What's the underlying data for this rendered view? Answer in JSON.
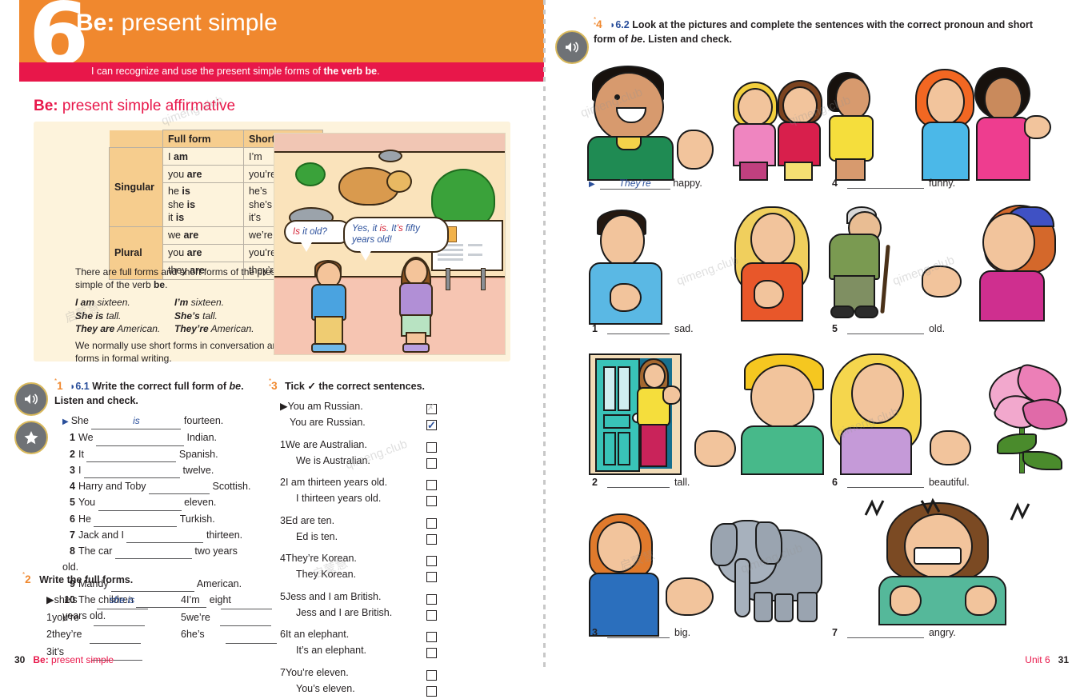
{
  "unit": {
    "number": "6",
    "title_bold": "Be:",
    "title_rest": " present simple",
    "can_do_prefix": "I can recognize and use the present simple forms of ",
    "can_do_bold": "the verb be",
    "can_do_suffix": "."
  },
  "section": {
    "title_bold": "Be:",
    "title_rest": " present simple affirmative"
  },
  "grammar_table": {
    "headers": [
      "",
      "Full form",
      "Short form"
    ],
    "groups": [
      {
        "label": "Singular",
        "rows": [
          {
            "full": "I am",
            "full_bold": "am",
            "short": "I’m"
          },
          {
            "full": "you are",
            "full_bold": "are",
            "short": "you’re"
          },
          {
            "full": "he is\nshe is\nit is",
            "full_bold": "is",
            "short": "he’s\nshe’s\nit’s"
          }
        ]
      },
      {
        "label": "Plural",
        "rows": [
          {
            "full": "we are",
            "full_bold": "are",
            "short": "we’re"
          },
          {
            "full": "you are",
            "full_bold": "are",
            "short": "you’re"
          },
          {
            "full": "they are",
            "full_bold": "are",
            "short": "they’re"
          }
        ]
      }
    ]
  },
  "grammar_notes": {
    "note1_a": "There are full forms and short forms of the present simple of the verb ",
    "note1_b": "be",
    "note1_c": ".",
    "examples": [
      {
        "full": "I am sixteen.",
        "short": "I’m sixteen."
      },
      {
        "full": "She is tall.",
        "short": "She’s tall."
      },
      {
        "full": "They are American.",
        "short": "They’re American."
      }
    ],
    "note2": "We normally use short forms in conversation and full forms in formal writing."
  },
  "illustration": {
    "bubble1_pre": "Is",
    "bubble1_rest": " it old?",
    "bubble2_pre": "Yes, it ",
    "bubble2_red1": "is",
    "bubble2_mid": ". It",
    "bubble2_red2": "’s",
    "bubble2_end": " fifty years old!",
    "caption": "turtle-zoo-scene"
  },
  "exercise1": {
    "stars": "*",
    "number": "1",
    "track": "6.1",
    "instruction_bold": "Write the correct full form of ",
    "instruction_italic": "be",
    "instruction_end": ". Listen and check.",
    "example": {
      "before": "She",
      "answer": "is",
      "after": "fourteen."
    },
    "items": [
      {
        "n": "1",
        "before": "We",
        "after": "Indian."
      },
      {
        "n": "2",
        "before": "It",
        "after": "Spanish."
      },
      {
        "n": "3",
        "before": "I",
        "after": "twelve."
      },
      {
        "n": "4",
        "before": "Harry and Toby",
        "after": "Scottish."
      },
      {
        "n": "5",
        "before": "You",
        "after": "eleven."
      },
      {
        "n": "6",
        "before": "He",
        "after": "Turkish."
      },
      {
        "n": "7",
        "before": "Jack and I",
        "after": "thirteen."
      },
      {
        "n": "8",
        "before": "The car",
        "after": "two years old."
      },
      {
        "n": "9",
        "before": "Mandy",
        "after": "American."
      },
      {
        "n": "10",
        "before": "The children",
        "after": "eight years old."
      }
    ]
  },
  "exercise2": {
    "stars": "*",
    "number": "2",
    "instruction": "Write the full forms.",
    "col1": [
      {
        "n": "▶",
        "prompt": "she’s",
        "answer": "she is"
      },
      {
        "n": "1",
        "prompt": "you’re",
        "answer": ""
      },
      {
        "n": "2",
        "prompt": "they’re",
        "answer": ""
      },
      {
        "n": "3",
        "prompt": "it’s",
        "answer": ""
      }
    ],
    "col2": [
      {
        "n": "4",
        "prompt": "I’m",
        "answer": ""
      },
      {
        "n": "5",
        "prompt": "we’re",
        "answer": ""
      },
      {
        "n": "6",
        "prompt": "he’s",
        "answer": ""
      }
    ]
  },
  "exercise3": {
    "stars": "**",
    "number": "3",
    "instruction_a": "Tick ",
    "instruction_tick": "✓",
    "instruction_b": " the correct sentences.",
    "groups": [
      {
        "n": "▶",
        "a": "You am Russian.",
        "a_state": "crossed",
        "b": "You are Russian.",
        "b_state": "ticked"
      },
      {
        "n": "1",
        "a": "We are Australian.",
        "a_state": "empty",
        "b": "We is Australian.",
        "b_state": "empty"
      },
      {
        "n": "2",
        "a": "I am thirteen years old.",
        "a_state": "empty",
        "b": "I thirteen years old.",
        "b_state": "empty"
      },
      {
        "n": "3",
        "a": "Ed are ten.",
        "a_state": "empty",
        "b": "Ed is ten.",
        "b_state": "empty"
      },
      {
        "n": "4",
        "a": "They’re Korean.",
        "a_state": "empty",
        "b": "They Korean.",
        "b_state": "empty"
      },
      {
        "n": "5",
        "a": "Jess and I am British.",
        "a_state": "empty",
        "b": "Jess and I are British.",
        "b_state": "empty"
      },
      {
        "n": "6",
        "a": "It an elephant.",
        "a_state": "empty",
        "b": "It’s an elephant.",
        "b_state": "empty"
      },
      {
        "n": "7",
        "a": "You’re eleven.",
        "a_state": "empty",
        "b": "You’s eleven.",
        "b_state": "empty"
      }
    ]
  },
  "exercise4": {
    "stars": "**",
    "number": "4",
    "track": "6.2",
    "instruction": "Look at the pictures and complete the sentences with the correct pronoun and short form of ",
    "instruction_italic": "be",
    "instruction_end": ". Listen and check.",
    "answers": [
      {
        "n": "▶",
        "answer": "They’re",
        "word": "happy.",
        "picture": "boy-pointing-at-two-happy-girls"
      },
      {
        "n": "1",
        "answer": "",
        "word": "sad.",
        "picture": "sad-boy-and-sad-girl"
      },
      {
        "n": "2",
        "answer": "",
        "word": "tall.",
        "picture": "woman-in-doorway-and-boy-pointing"
      },
      {
        "n": "3",
        "answer": "",
        "word": "big.",
        "picture": "woman-pointing-at-elephant"
      },
      {
        "n": "4",
        "answer": "",
        "word": "funny.",
        "picture": "boy-pointing-at-two-laughing-girls"
      },
      {
        "n": "5",
        "answer": "",
        "word": "old.",
        "picture": "old-man-with-cane-and-girl-pointing"
      },
      {
        "n": "6",
        "answer": "",
        "word": "beautiful.",
        "picture": "girl-pointing-at-lily-flower"
      },
      {
        "n": "7",
        "answer": "",
        "word": "angry.",
        "picture": "angry-woman"
      }
    ]
  },
  "footer": {
    "left_page": "30",
    "left_title_bold": "Be:",
    "left_title_rest": " present simple",
    "right_unit": "Unit 6",
    "right_page": "31"
  },
  "watermarks": [
    "qimeng.club",
    "启蒙慧",
    "qimeng.club",
    "启蒙慧",
    "qimeng.club",
    "qimeng.club",
    "启蒙慧",
    "qimeng.club"
  ],
  "colors": {
    "orange": "#f0882e",
    "red": "#e8174a",
    "blue": "#2a4f9b",
    "cream": "#fdf3dc",
    "tan": "#f6cd8e"
  }
}
